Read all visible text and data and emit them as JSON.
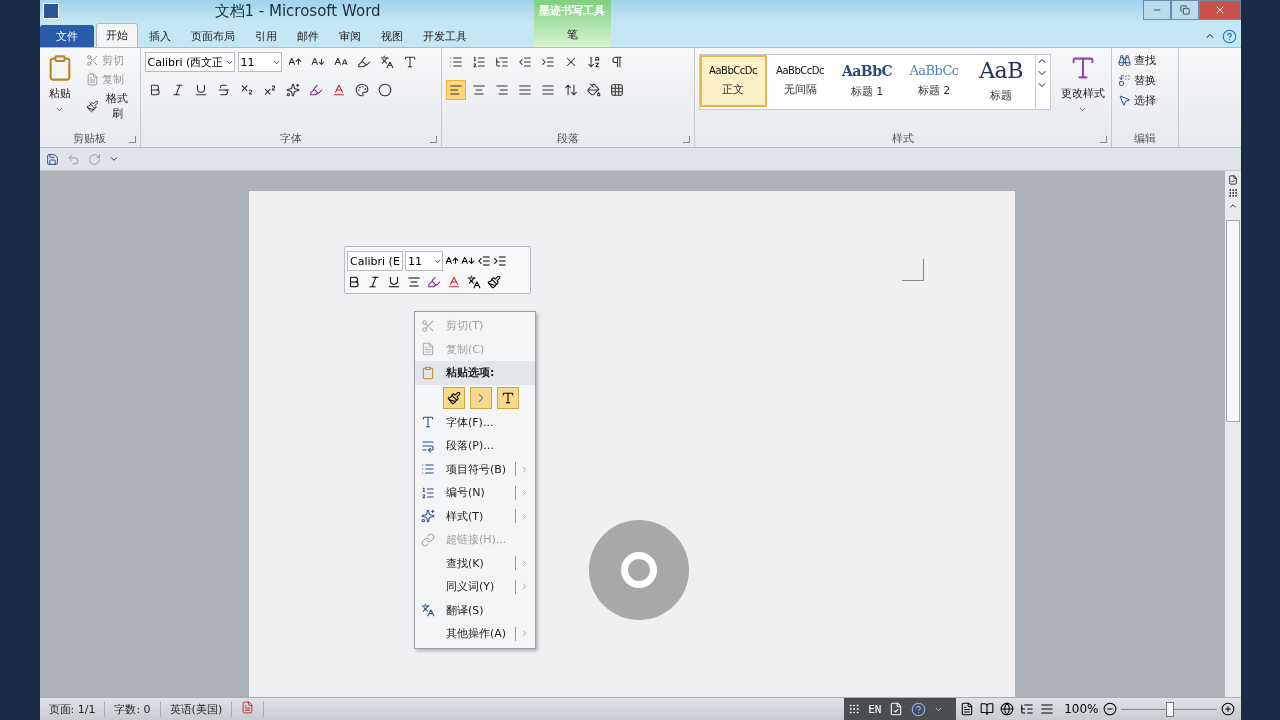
{
  "window": {
    "title": "文档1 - Microsoft Word",
    "contextual_tab": {
      "group": "墨迹书写工具",
      "tab": "笔"
    }
  },
  "tabs": [
    {
      "label": "文件",
      "kind": "file",
      "selected": false
    },
    {
      "label": "开始",
      "kind": "tab",
      "selected": true
    },
    {
      "label": "插入",
      "kind": "tab",
      "selected": false
    },
    {
      "label": "页面布局",
      "kind": "tab",
      "selected": false
    },
    {
      "label": "引用",
      "kind": "tab",
      "selected": false
    },
    {
      "label": "邮件",
      "kind": "tab",
      "selected": false
    },
    {
      "label": "审阅",
      "kind": "tab",
      "selected": false
    },
    {
      "label": "视图",
      "kind": "tab",
      "selected": false
    },
    {
      "label": "开发工具",
      "kind": "tab",
      "selected": false
    }
  ],
  "ribbon": {
    "clipboard": {
      "label": "剪贴板",
      "paste": "粘贴",
      "items": [
        {
          "label": "剪切",
          "disabled": true
        },
        {
          "label": "复制",
          "disabled": true
        },
        {
          "label": "格式刷",
          "disabled": false
        }
      ]
    },
    "font": {
      "label": "字体",
      "font_name": "Calibri (西文正",
      "font_size": "11"
    },
    "paragraph": {
      "label": "段落",
      "alignments": [
        {
          "selected": true
        },
        {
          "selected": false
        },
        {
          "selected": false
        },
        {
          "selected": false
        },
        {
          "selected": false
        }
      ]
    },
    "styles": {
      "label": "样式",
      "items": [
        {
          "preview": "AaBbCcDc",
          "name": "正文",
          "kind": "plain",
          "selected": true
        },
        {
          "preview": "AaBbCcDc",
          "name": "无间隔",
          "kind": "plain",
          "selected": false
        },
        {
          "preview": "AaBbC",
          "name": "标题 1",
          "kind": "heading1",
          "selected": false
        },
        {
          "preview": "AaBbCc",
          "name": "标题 2",
          "kind": "heading2",
          "selected": false
        },
        {
          "preview": "AaB",
          "name": "标题",
          "kind": "title",
          "selected": false
        }
      ],
      "change_styles": "更改样式"
    },
    "editing": {
      "label": "编辑",
      "items": [
        "查找",
        "替换",
        "选择"
      ]
    }
  },
  "mini_toolbar": {
    "font_name": "Calibri (E",
    "font_size": "11"
  },
  "context_menu": [
    {
      "kind": "item",
      "label": "剪切(T)",
      "disabled": true,
      "submenu": false
    },
    {
      "kind": "item",
      "label": "复制(C)",
      "disabled": true,
      "submenu": false
    },
    {
      "kind": "header",
      "label": "粘贴选项:"
    },
    {
      "kind": "paste_options"
    },
    {
      "kind": "item",
      "label": "字体(F)...",
      "disabled": false,
      "submenu": false
    },
    {
      "kind": "item",
      "label": "段落(P)...",
      "disabled": false,
      "submenu": false
    },
    {
      "kind": "item",
      "label": "项目符号(B)",
      "disabled": false,
      "submenu": true
    },
    {
      "kind": "item",
      "label": "编号(N)",
      "disabled": false,
      "submenu": true
    },
    {
      "kind": "item",
      "label": "样式(T)",
      "disabled": false,
      "submenu": true
    },
    {
      "kind": "item",
      "label": "超链接(H)...",
      "disabled": true,
      "submenu": false
    },
    {
      "kind": "item",
      "label": "查找(K)",
      "disabled": false,
      "submenu": true
    },
    {
      "kind": "item",
      "label": "同义词(Y)",
      "disabled": false,
      "submenu": true
    },
    {
      "kind": "item",
      "label": "翻译(S)",
      "disabled": false,
      "submenu": false
    },
    {
      "kind": "item",
      "label": "其他操作(A)",
      "disabled": false,
      "submenu": true
    }
  ],
  "status_bar": {
    "items": [
      "页面: 1/1",
      "字数: 0",
      "英语(美国)"
    ],
    "ime": "EN",
    "zoom": "100%",
    "zoom_slider": {
      "level": 0.5
    }
  }
}
